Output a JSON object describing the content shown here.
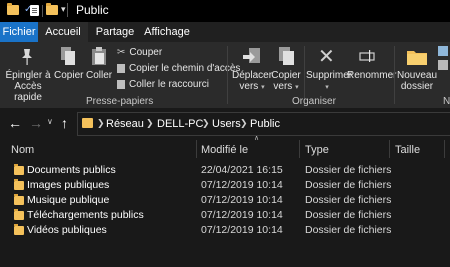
{
  "window": {
    "title": "Public"
  },
  "tabs": [
    "Fichier",
    "Accueil",
    "Partage",
    "Affichage"
  ],
  "ribbon": {
    "pin": [
      "Épingler à",
      "Accès rapide"
    ],
    "copy": "Copier",
    "paste": "Coller",
    "cut": "Couper",
    "copy_path": "Copier le chemin d'accès",
    "paste_shortcut": "Coller le raccourci",
    "clipboard_group": "Presse-papiers",
    "move_to": [
      "Déplacer",
      "vers"
    ],
    "copy_to": [
      "Copier",
      "vers"
    ],
    "delete": "Supprimer",
    "rename": "Renommer",
    "organize_group": "Organiser",
    "new_folder": [
      "Nouveau",
      "dossier"
    ],
    "new_group_partial": "N"
  },
  "address": {
    "crumbs": [
      "Réseau",
      "DELL-PC",
      "Users",
      "Public"
    ]
  },
  "columns": [
    "Nom",
    "Modifié le",
    "Type",
    "Taille"
  ],
  "files": [
    {
      "name": "Documents publics",
      "modified": "22/04/2021 16:15",
      "type": "Dossier de fichiers",
      "size": ""
    },
    {
      "name": "Images publiques",
      "modified": "07/12/2019 10:14",
      "type": "Dossier de fichiers",
      "size": ""
    },
    {
      "name": "Musique publique",
      "modified": "07/12/2019 10:14",
      "type": "Dossier de fichiers",
      "size": ""
    },
    {
      "name": "Téléchargements publics",
      "modified": "07/12/2019 10:14",
      "type": "Dossier de fichiers",
      "size": ""
    },
    {
      "name": "Vidéos publiques",
      "modified": "07/12/2019 10:14",
      "type": "Dossier de fichiers",
      "size": ""
    }
  ],
  "colors": {
    "accent": "#1a73c8",
    "folder": "#f4c15b",
    "background": "#191919",
    "ribbon": "#2b2b2b"
  }
}
